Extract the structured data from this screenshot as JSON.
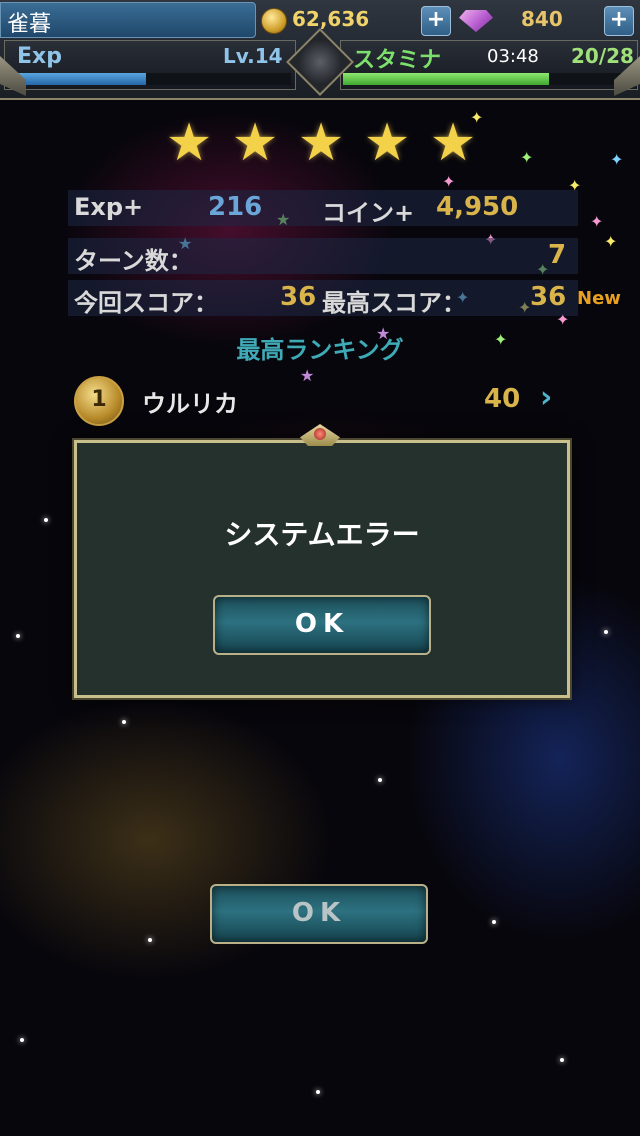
{
  "player": {
    "name": "雀暮"
  },
  "currency": {
    "coins": "62,636",
    "coin_icon": "coin-icon",
    "gems": "840",
    "gem_icon": "gem-icon",
    "add_label": "+"
  },
  "status": {
    "exp_label": "Exp",
    "level": "Lv.14",
    "exp_fill": 0.49,
    "stamina_label": "スタミナ",
    "stamina_timer": "03:48",
    "stamina": "20/28",
    "stamina_fill": 0.71
  },
  "result": {
    "stars": 5,
    "exp_label": "Exp+",
    "exp_gain": "216",
    "coin_label": "コイン+",
    "coin_gain": "4,950",
    "turns_label": "ターン数：",
    "turns": "7",
    "score_label": "今回スコア：",
    "score": "36",
    "best_label": "最高スコア：",
    "best": "36",
    "new_badge": "New"
  },
  "ranking": {
    "title": "最高ランキング",
    "entries": [
      {
        "rank": "1",
        "name": "ウルリカ",
        "score": "40"
      }
    ]
  },
  "dialog": {
    "message": "システムエラー",
    "ok": "OK"
  },
  "background_button": {
    "ok": "OK"
  },
  "colors": {
    "accent": "#3fa9b6",
    "gold": "#d9b44a",
    "exp_blue": "#6aa6d8",
    "stamina_green": "#7ee06c"
  }
}
